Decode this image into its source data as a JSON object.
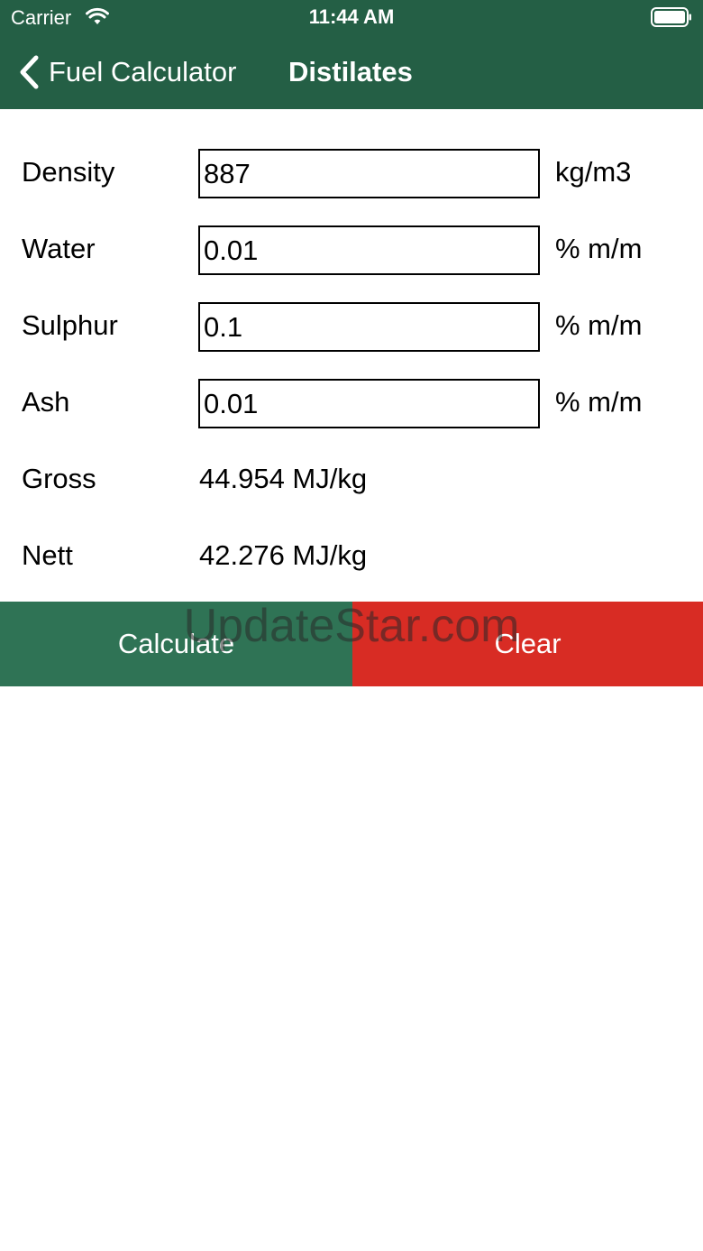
{
  "status_bar": {
    "carrier": "Carrier",
    "time": "11:44 AM"
  },
  "nav": {
    "back_label": "Fuel Calculator",
    "title": "Distilates"
  },
  "form": {
    "density": {
      "label": "Density",
      "value": "887",
      "unit": "kg/m3"
    },
    "water": {
      "label": "Water",
      "value": "0.01",
      "unit": "% m/m"
    },
    "sulphur": {
      "label": "Sulphur",
      "value": "0.1",
      "unit": "% m/m"
    },
    "ash": {
      "label": "Ash",
      "value": "0.01",
      "unit": "% m/m"
    }
  },
  "results": {
    "gross": {
      "label": "Gross",
      "value": "44.954 MJ/kg"
    },
    "nett": {
      "label": "Nett",
      "value": "42.276 MJ/kg"
    }
  },
  "buttons": {
    "calculate_label": "Calculate",
    "clear_label": "Clear"
  },
  "watermark": "UpdateStar.com",
  "colors": {
    "header": "#245f45",
    "calculate": "#2f7355",
    "clear": "#d82c24"
  },
  "icons": [
    "wifi-icon",
    "battery-icon",
    "back-chevron-icon"
  ]
}
